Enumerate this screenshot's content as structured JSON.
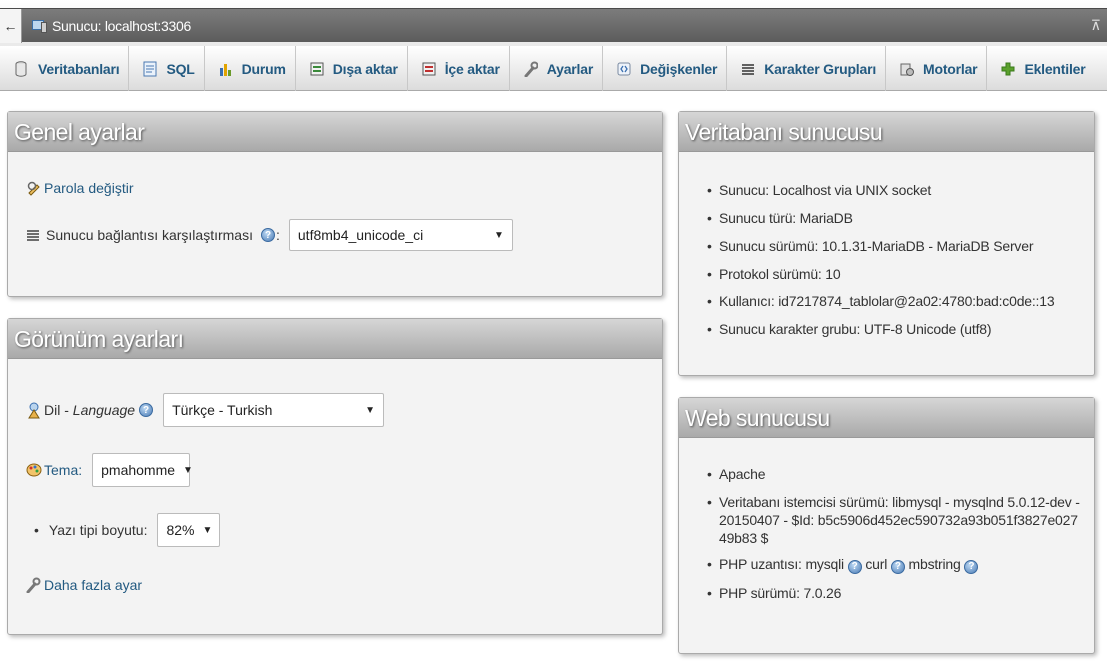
{
  "header": {
    "back_symbol": "←",
    "server_title": "Sunucu: localhost:3306",
    "collapse_symbol": "⊼"
  },
  "menu": [
    {
      "label": "Veritabanları",
      "icon": "database-icon"
    },
    {
      "label": "SQL",
      "icon": "sql-icon"
    },
    {
      "label": "Durum",
      "icon": "status-icon"
    },
    {
      "label": "Dışa aktar",
      "icon": "export-icon"
    },
    {
      "label": "İçe aktar",
      "icon": "import-icon"
    },
    {
      "label": "Ayarlar",
      "icon": "wrench-icon"
    },
    {
      "label": "Değişkenler",
      "icon": "variables-icon"
    },
    {
      "label": "Karakter Grupları",
      "icon": "charset-icon"
    },
    {
      "label": "Motorlar",
      "icon": "engines-icon"
    },
    {
      "label": "Eklentiler",
      "icon": "plugins-icon"
    }
  ],
  "general": {
    "title": "Genel ayarlar",
    "change_password": "Parola değiştir",
    "collation_label": "Sunucu bağlantısı karşılaştırması",
    "collation_value": "utf8mb4_unicode_ci"
  },
  "appearance": {
    "title": "Görünüm ayarları",
    "language_label_prefix": "Dil - ",
    "language_label_en": "Language",
    "language_value": "Türkçe - Turkish",
    "theme_label": "Tema:",
    "theme_value": "pmahomme",
    "font_size_label": "Yazı tipi boyutu:",
    "font_size_value": "82%",
    "more_settings": "Daha fazla ayar"
  },
  "db_server": {
    "title": "Veritabanı sunucusu",
    "items": [
      "Sunucu: Localhost via UNIX socket",
      "Sunucu türü: MariaDB",
      "Sunucu sürümü: 10.1.31-MariaDB - MariaDB Server",
      "Protokol sürümü: 10",
      "Kullanıcı: id7217874_tablolar@2a02:4780:bad:c0de::13",
      "Sunucu karakter grubu: UTF-8 Unicode (utf8)"
    ]
  },
  "web_server": {
    "title": "Web sunucusu",
    "software": "Apache",
    "client_version": "Veritabanı istemcisi sürümü: libmysql - mysqlnd 5.0.12-dev - 20150407 - $Id: b5c5906d452ec590732a93b051f3827e02749b83 $",
    "php_ext_label": "PHP uzantısı:",
    "php_extensions": [
      "mysqli",
      "curl",
      "mbstring"
    ],
    "php_version": "PHP sürümü: 7.0.26"
  },
  "help_symbol": "?",
  "colors": {
    "link": "#235a81",
    "panel_bg": "#f3f3f3",
    "header_bar": "#666666"
  }
}
